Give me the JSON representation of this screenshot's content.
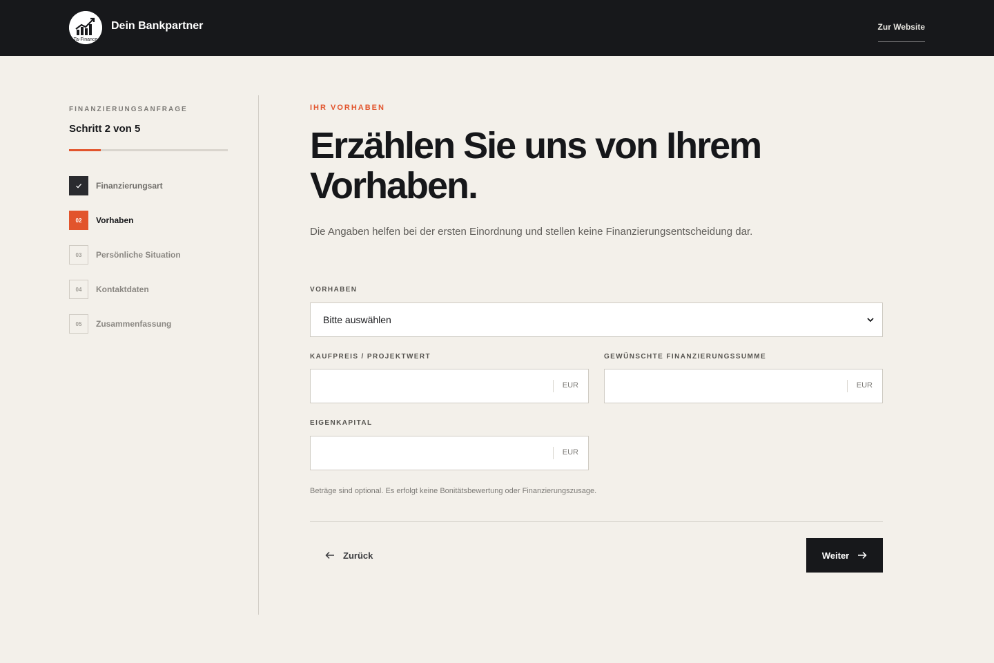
{
  "header": {
    "brand": "Dein Bankpartner",
    "logo_text": "Ta-Finance",
    "website_link": "Zur Website"
  },
  "sidebar": {
    "eyebrow": "FINANZIERUNGSANFRAGE",
    "step_count": "Schritt 2 von 5",
    "progress_fraction": 0.2,
    "steps": [
      {
        "number": "",
        "label": "Finanzierungsart",
        "state": "done",
        "icon": "check-icon"
      },
      {
        "number": "02",
        "label": "Vorhaben",
        "state": "active"
      },
      {
        "number": "03",
        "label": "Persönliche Situation",
        "state": "pending"
      },
      {
        "number": "04",
        "label": "Kontaktdaten",
        "state": "pending"
      },
      {
        "number": "05",
        "label": "Zusammenfassung",
        "state": "pending"
      }
    ]
  },
  "main": {
    "eyebrow": "IHR VORHABEN",
    "headline_line1": "Erzählen Sie uns von Ihrem",
    "headline_line2": "Vorhaben.",
    "lead": "Die Angaben helfen bei der ersten Einordnung und stellen keine Finanzierungsentscheidung dar.",
    "fields": {
      "vorhaben": {
        "label": "VORHABEN",
        "value": "Bitte auswählen"
      },
      "kaufpreis": {
        "label": "KAUFPREIS / PROJEKTWERT",
        "value": "",
        "unit": "EUR"
      },
      "finanzierungssumme": {
        "label": "GEWÜNSCHTE FINANZIERUNGSSUMME",
        "value": "",
        "unit": "EUR"
      },
      "eigenkapital": {
        "label": "EIGENKAPITAL",
        "value": "",
        "unit": "EUR"
      }
    },
    "hint": "Beträge sind optional. Es erfolgt keine Bonitätsbewertung oder Finanzierungszusage.",
    "back_label": "Zurück",
    "next_label": "Weiter"
  },
  "colors": {
    "accent": "#e2542c",
    "dark": "#17181b",
    "background": "#f3f0ea"
  }
}
